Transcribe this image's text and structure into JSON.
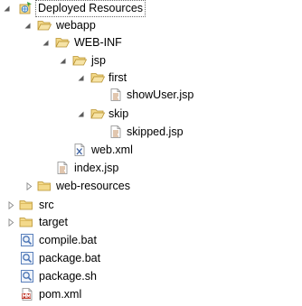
{
  "tree": {
    "deployed_resources": {
      "label": "Deployed Resources",
      "icon": "deployed-resources-icon",
      "expanded": true
    },
    "webapp": {
      "label": "webapp",
      "icon": "folder-icon",
      "expanded": true
    },
    "web_inf": {
      "label": "WEB-INF",
      "icon": "folder-icon",
      "expanded": true
    },
    "jsp": {
      "label": "jsp",
      "icon": "folder-icon",
      "expanded": true
    },
    "first": {
      "label": "first",
      "icon": "folder-icon",
      "expanded": true
    },
    "show_user": {
      "label": "showUser.jsp",
      "icon": "jsp-file-icon"
    },
    "skip": {
      "label": "skip",
      "icon": "folder-icon",
      "expanded": true
    },
    "skipped": {
      "label": "skipped.jsp",
      "icon": "jsp-file-icon"
    },
    "web_xml": {
      "label": "web.xml",
      "icon": "xml-file-icon"
    },
    "index_jsp": {
      "label": "index.jsp",
      "icon": "jsp-file-icon"
    },
    "web_resources": {
      "label": "web-resources",
      "icon": "folder-icon",
      "expanded": false
    },
    "src": {
      "label": "src",
      "icon": "folder-icon",
      "expanded": false
    },
    "target": {
      "label": "target",
      "icon": "folder-icon",
      "expanded": false
    },
    "compile_bat": {
      "label": "compile.bat",
      "icon": "script-file-icon"
    },
    "package_bat": {
      "label": "package.bat",
      "icon": "script-file-icon"
    },
    "package_sh": {
      "label": "package.sh",
      "icon": "script-file-icon"
    },
    "pom_xml": {
      "label": "pom.xml",
      "icon": "maven-pom-icon"
    }
  },
  "colors": {
    "folder": "#e9c46a",
    "folder_dark": "#c9a23a",
    "twisty": "#7a7a7a",
    "file_border": "#8a8a8a",
    "script_blue": "#4a74b5",
    "pom_red": "#c0392b"
  }
}
